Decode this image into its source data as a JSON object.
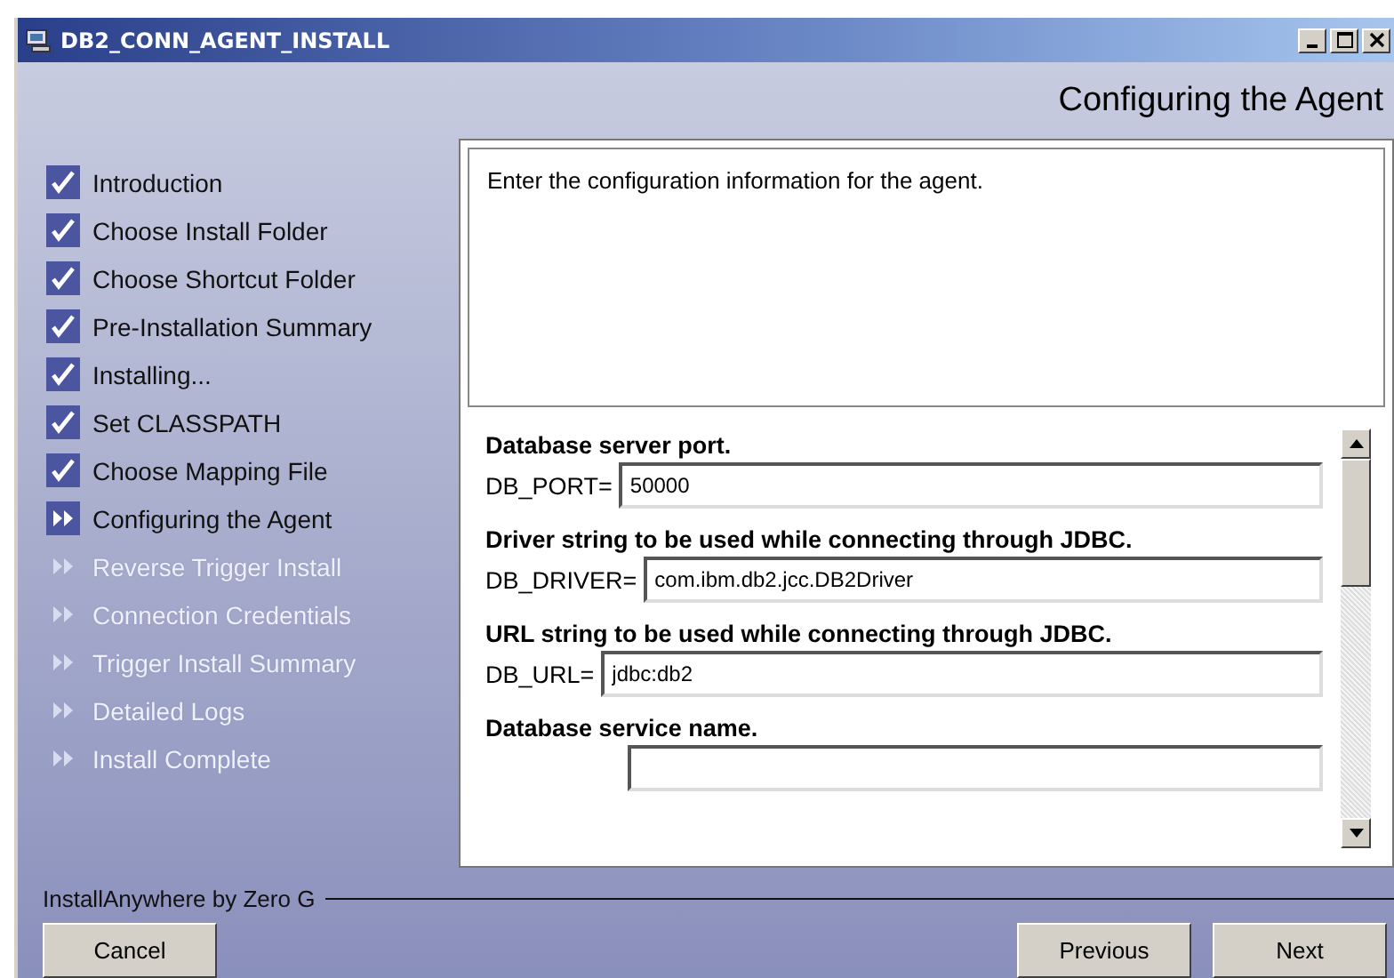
{
  "window": {
    "title": "DB2_CONN_AGENT_INSTALL"
  },
  "header": {
    "title": "Configuring the Agent"
  },
  "steps": [
    {
      "label": "Introduction",
      "checked": true,
      "disabled": false
    },
    {
      "label": "Choose Install Folder",
      "checked": true,
      "disabled": false
    },
    {
      "label": "Choose Shortcut Folder",
      "checked": true,
      "disabled": false
    },
    {
      "label": "Pre-Installation Summary",
      "checked": true,
      "disabled": false
    },
    {
      "label": "Installing...",
      "checked": true,
      "disabled": false
    },
    {
      "label": "Set CLASSPATH",
      "checked": true,
      "disabled": false
    },
    {
      "label": "Choose Mapping File",
      "checked": true,
      "disabled": false
    },
    {
      "label": "Configuring the Agent",
      "checked": false,
      "disabled": false
    },
    {
      "label": "Reverse Trigger Install",
      "checked": false,
      "disabled": true
    },
    {
      "label": "Connection Credentials",
      "checked": false,
      "disabled": true
    },
    {
      "label": "Trigger Install Summary",
      "checked": false,
      "disabled": true
    },
    {
      "label": "Detailed Logs",
      "checked": false,
      "disabled": true
    },
    {
      "label": "Install Complete",
      "checked": false,
      "disabled": true
    }
  ],
  "description": "Enter the configuration information for the agent.",
  "fields": [
    {
      "heading": "Database server port.",
      "label": "DB_PORT=",
      "value": "50000"
    },
    {
      "heading": "Driver string to be used while connecting through JDBC.",
      "label": "DB_DRIVER=",
      "value": "com.ibm.db2.jcc.DB2Driver"
    },
    {
      "heading": "URL string to be used while connecting through JDBC.",
      "label": "DB_URL=",
      "value": "jdbc:db2"
    },
    {
      "heading": "Database service name."
    }
  ],
  "footer": {
    "vendor": "InstallAnywhere by Zero G"
  },
  "buttons": {
    "cancel": "Cancel",
    "previous": "Previous",
    "next": "Next"
  }
}
